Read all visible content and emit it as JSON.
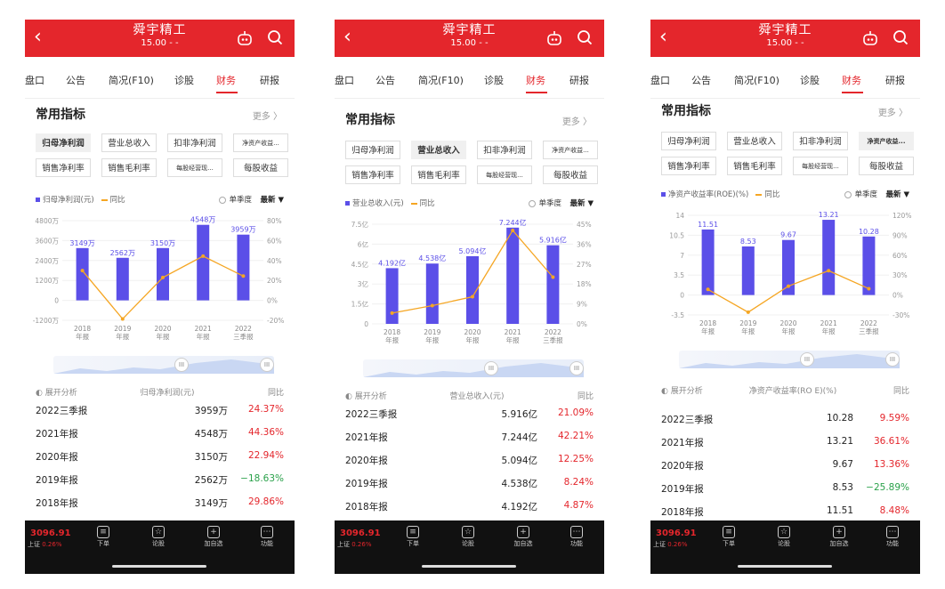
{
  "screens": [
    {
      "title": "舜宇精工",
      "price": "15.00 - -",
      "tabs": [
        "盘口",
        "公告",
        "简况(F10)",
        "诊股",
        "财务",
        "研报"
      ],
      "active_tab": 4,
      "section_title": "常用指标",
      "more": "更多 〉",
      "chips": [
        "归母净利润",
        "营业总收入",
        "扣非净利润",
        "净资产收益...",
        "销售净利率",
        "销售毛利率",
        "每股经营现...",
        "每股收益"
      ],
      "selected_chip": 0,
      "legend_bar": "归母净利润(元)",
      "legend_line": "同比",
      "period": "单季度",
      "latest": "最新 ▼",
      "table_header": [
        "展开分析",
        "归母净利润(元)",
        "同比"
      ],
      "rows": [
        [
          "2022三季报",
          "3959万",
          "24.37%"
        ],
        [
          "2021年报",
          "4548万",
          "44.36%"
        ],
        [
          "2020年报",
          "3150万",
          "22.94%"
        ],
        [
          "2019年报",
          "2562万",
          "−18.63%"
        ],
        [
          "2018年报",
          "3149万",
          "29.86%"
        ]
      ],
      "footer": {
        "index": "3096.91",
        "market": "上证",
        "change": "0.26%",
        "items": [
          "下单",
          "论股",
          "加自选",
          "功能"
        ]
      },
      "chart_data": {
        "type": "bar",
        "categories": [
          "2018\n年报",
          "2019\n年报",
          "2020\n年报",
          "2021\n年报",
          "2022\n三季报"
        ],
        "series": [
          {
            "name": "归母净利润(元)",
            "values": [
              31.49,
              25.62,
              31.5,
              45.48,
              39.59
            ],
            "labels": [
              "3149万",
              "2562万",
              "3150万",
              "4548万",
              "3959万"
            ]
          },
          {
            "name": "同比",
            "values": [
              29.86,
              -18.63,
              22.94,
              44.36,
              24.37
            ]
          }
        ],
        "y_left_ticks": [
          "4800万",
          "3600万",
          "2400万",
          "1200万",
          "0",
          "-1200万"
        ],
        "y_left_range": [
          -12,
          48
        ],
        "y_right_ticks": [
          "80%",
          "60%",
          "40%",
          "20%",
          "0%",
          "-20%"
        ],
        "y_right_range": [
          -20,
          80
        ]
      }
    },
    {
      "title": "舜宇精工",
      "price": "15.00 - -",
      "tabs": [
        "盘口",
        "公告",
        "简况(F10)",
        "诊股",
        "财务",
        "研报"
      ],
      "active_tab": 4,
      "section_title": "常用指标",
      "more": "更多 〉",
      "chips": [
        "归母净利润",
        "营业总收入",
        "扣非净利润",
        "净资产收益...",
        "销售净利率",
        "销售毛利率",
        "每股经营现...",
        "每股收益"
      ],
      "selected_chip": 1,
      "legend_bar": "营业总收入(元)",
      "legend_line": "同比",
      "period": "单季度",
      "latest": "最新 ▼",
      "table_header": [
        "展开分析",
        "营业总收入(元)",
        "同比"
      ],
      "rows": [
        [
          "2022三季报",
          "5.916亿",
          "21.09%"
        ],
        [
          "2021年报",
          "7.244亿",
          "42.21%"
        ],
        [
          "2020年报",
          "5.094亿",
          "12.25%"
        ],
        [
          "2019年报",
          "4.538亿",
          "8.24%"
        ],
        [
          "2018年报",
          "4.192亿",
          "4.87%"
        ]
      ],
      "footer": {
        "index": "3096.91",
        "market": "上证",
        "change": "0.26%",
        "items": [
          "下单",
          "论股",
          "加自选",
          "功能"
        ]
      },
      "chart_data": {
        "type": "bar",
        "categories": [
          "2018\n年报",
          "2019\n年报",
          "2020\n年报",
          "2021\n年报",
          "2022\n三季报"
        ],
        "series": [
          {
            "name": "营业总收入(元)",
            "values": [
              4.192,
              4.538,
              5.094,
              7.244,
              5.916
            ],
            "labels": [
              "4.192亿",
              "4.538亿",
              "5.094亿",
              "7.244亿",
              "5.916亿"
            ]
          },
          {
            "name": "同比",
            "values": [
              4.87,
              8.24,
              12.25,
              42.21,
              21.09
            ]
          }
        ],
        "y_left_ticks": [
          "7.5亿",
          "6亿",
          "4.5亿",
          "3亿",
          "1.5亿",
          "0"
        ],
        "y_left_range": [
          0,
          7.5
        ],
        "y_right_ticks": [
          "45%",
          "36%",
          "27%",
          "18%",
          "9%",
          "0%"
        ],
        "y_right_range": [
          0,
          45
        ]
      }
    },
    {
      "title": "舜宇精工",
      "price": "15.00 - -",
      "tabs": [
        "盘口",
        "公告",
        "简况(F10)",
        "诊股",
        "财务",
        "研报"
      ],
      "active_tab": 4,
      "section_title": "常用指标",
      "more": "更多 〉",
      "chips": [
        "归母净利润",
        "营业总收入",
        "扣非净利润",
        "净资产收益...",
        "销售净利率",
        "销售毛利率",
        "每股经营现...",
        "每股收益"
      ],
      "selected_chip": 3,
      "legend_bar": "净资产收益率(ROE)(%)",
      "legend_line": "同比",
      "period": "单季度",
      "latest": "最新 ▼",
      "table_header": [
        "展开分析",
        "净资产收益率(RO E)(%)",
        "同比"
      ],
      "rows": [
        [
          "2022三季报",
          "10.28",
          "9.59%"
        ],
        [
          "2021年报",
          "13.21",
          "36.61%"
        ],
        [
          "2020年报",
          "9.67",
          "13.36%"
        ],
        [
          "2019年报",
          "8.53",
          "−25.89%"
        ],
        [
          "2018年报",
          "11.51",
          "8.48%"
        ]
      ],
      "footer": {
        "index": "3096.91",
        "market": "上证",
        "change": "0.26%",
        "items": [
          "下单",
          "论股",
          "加自选",
          "功能"
        ]
      },
      "chart_data": {
        "type": "bar",
        "categories": [
          "2018\n年报",
          "2019\n年报",
          "2020\n年报",
          "2021\n年报",
          "2022\n三季报"
        ],
        "series": [
          {
            "name": "净资产收益率(ROE)(%)",
            "values": [
              11.51,
              8.53,
              9.67,
              13.21,
              10.28
            ],
            "labels": [
              "11.51",
              "8.53",
              "9.67",
              "13.21",
              "10.28"
            ]
          },
          {
            "name": "同比",
            "values": [
              8.48,
              -25.89,
              13.36,
              36.61,
              9.59
            ]
          }
        ],
        "y_left_ticks": [
          "14",
          "10.5",
          "7",
          "3.5",
          "0",
          "-3.5"
        ],
        "y_left_range": [
          -3.5,
          14
        ],
        "y_right_ticks": [
          "120%",
          "90%",
          "60%",
          "30%",
          "0%",
          "-30%"
        ],
        "y_right_range": [
          -30,
          120
        ]
      }
    }
  ],
  "colors": {
    "brand_red": "#e4262c",
    "bar": "#5b4fe8",
    "line": "#f5a623",
    "up": "#e4262c",
    "down": "#2aa14a"
  }
}
